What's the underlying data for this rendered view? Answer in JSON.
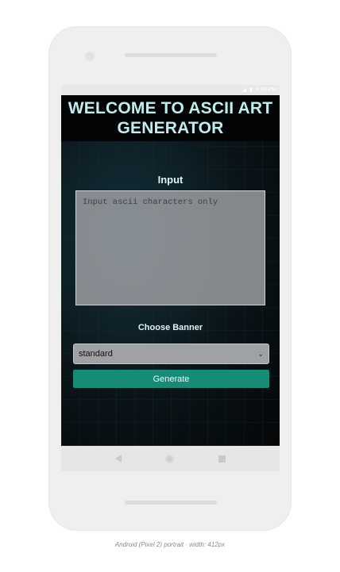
{
  "status_bar": {
    "time": "4:35 PM",
    "icons": [
      "signal-icon",
      "battery-icon"
    ]
  },
  "app": {
    "title": "WELCOME TO ASCII ART GENERATOR",
    "input_label": "Input",
    "textarea_placeholder": "Input ascii characters only",
    "textarea_value": "",
    "banner_label": "Choose Banner",
    "banner_selected": "standard",
    "generate_label": "Generate",
    "colors": {
      "title": "#bfeef0",
      "button": "#168c76",
      "background": "#0b0d10"
    }
  },
  "nav": {
    "icons": [
      "back-icon",
      "home-icon",
      "recents-icon"
    ]
  },
  "caption": "Android (Pixel 2) portrait · width: 412px"
}
